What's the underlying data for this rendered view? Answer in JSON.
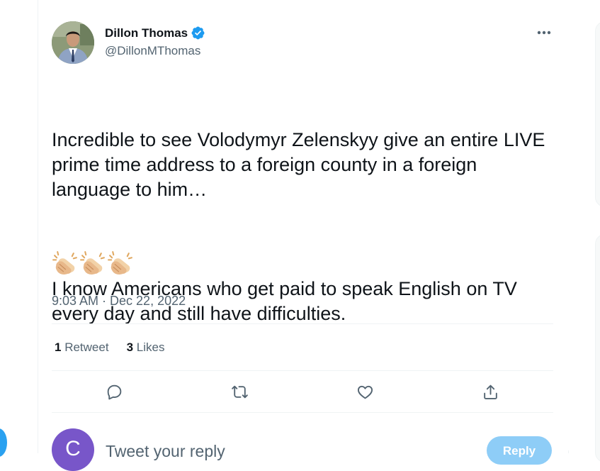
{
  "author": {
    "name": "Dillon Thomas",
    "handle": "@DillonMThomas",
    "verified": true
  },
  "tweet": {
    "paragraphs": [
      "Incredible to see Volodymyr Zelenskyy give an entire LIVE prime time address to a foreign county in a foreign language to him…",
      "I know Americans who get paid to speak English on TV every day and still have difficulties."
    ],
    "emoji": [
      "clapping-hands",
      "clapping-hands",
      "clapping-hands"
    ],
    "timestamp": "9:03 AM · Dec 22, 2022"
  },
  "stats": {
    "retweets_count": "1",
    "retweets_label": "Retweet",
    "likes_count": "3",
    "likes_label": "Likes"
  },
  "actions": [
    "reply-icon",
    "retweet-icon",
    "like-icon",
    "share-icon"
  ],
  "reply_box": {
    "avatar_letter": "C",
    "placeholder": "Tweet your reply",
    "button_label": "Reply"
  },
  "colors": {
    "accent": "#1d9bf0",
    "secondary_text": "#536471",
    "reply_avatar": "#7856c9",
    "reply_button_disabled": "#8ecdf7"
  }
}
